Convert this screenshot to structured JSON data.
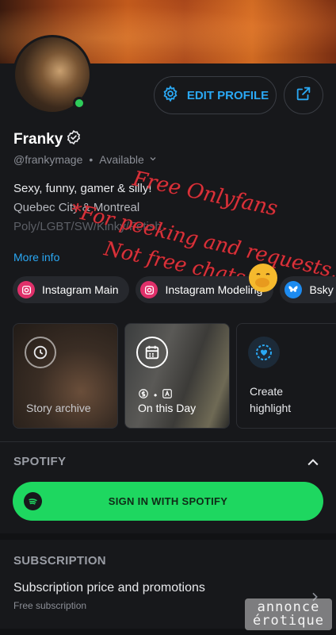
{
  "profile": {
    "name": "Franky",
    "handle": "@frankymage",
    "separator": "•",
    "availability": "Available",
    "bio_lines": [
      "Sexy, funny, gamer & silly!",
      "Quebec City & Montreal",
      "Poly/LGBT/SW/Kinky/Fetish"
    ],
    "more_info": "More info"
  },
  "header": {
    "edit_profile": "EDIT PROFILE"
  },
  "overlay": {
    "line1": "Free Onlyfans",
    "line2": "*For peeking and requests,",
    "line3": "Not free chats"
  },
  "social_links": [
    {
      "label": "Instagram Main",
      "icon": "instagram-icon"
    },
    {
      "label": "Instagram Modeling",
      "icon": "instagram-icon"
    },
    {
      "label": "Bsky",
      "icon": "bluesky-icon"
    }
  ],
  "highlights": {
    "story_archive": "Story archive",
    "on_this_day": "On this Day",
    "create_highlight_1": "Create",
    "create_highlight_2": "highlight"
  },
  "spotify": {
    "section_title": "SPOTIFY",
    "button_label": "SIGN IN WITH SPOTIFY"
  },
  "subscription": {
    "section_title": "SUBSCRIPTION",
    "row_title": "Subscription price and promotions",
    "row_subtitle": "Free subscription"
  },
  "watermark": {
    "line1": "annonce",
    "line2": "érotique"
  },
  "colors": {
    "accent": "#2aa8f4",
    "spotify_green": "#1ed760",
    "online": "#2ecc5a",
    "overlay_red": "#d8323a",
    "background": "#17181b"
  }
}
